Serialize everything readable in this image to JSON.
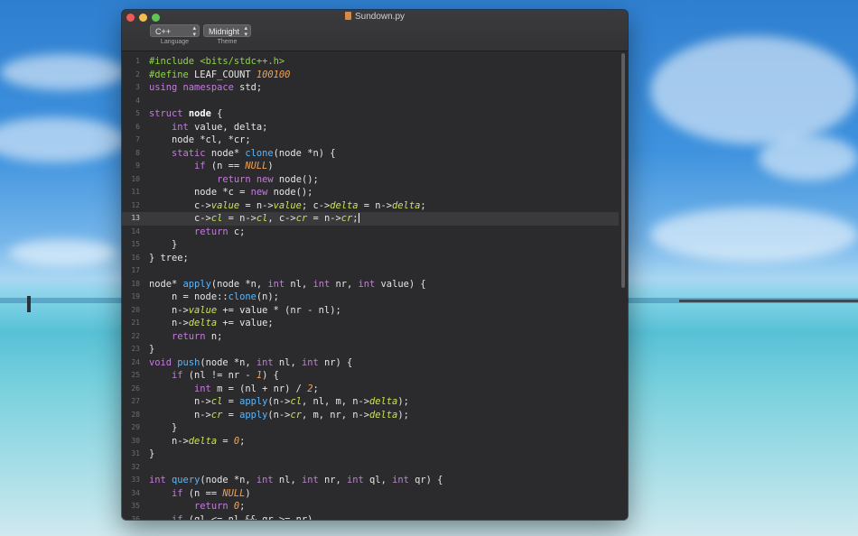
{
  "window": {
    "title": "Sundown.py"
  },
  "toolbar": {
    "language": {
      "value": "C++",
      "caption": "Language"
    },
    "theme": {
      "value": "Midnight",
      "caption": "Theme"
    }
  },
  "editor": {
    "current_line": 13,
    "lines": [
      "#include <bits/stdc++.h>",
      "#define LEAF_COUNT 100100",
      "using namespace std;",
      "",
      "struct node {",
      "    int value, delta;",
      "    node *cl, *cr;",
      "    static node* clone(node *n) {",
      "        if (n == NULL)",
      "            return new node();",
      "        node *c = new node();",
      "        c->value = n->value; c->delta = n->delta;",
      "        c->cl = n->cl, c->cr = n->cr;",
      "        return c;",
      "    }",
      "} tree;",
      "",
      "node* apply(node *n, int nl, int nr, int value) {",
      "    n = node::clone(n);",
      "    n->value += value * (nr - nl);",
      "    n->delta += value;",
      "    return n;",
      "}",
      "void push(node *n, int nl, int nr) {",
      "    if (nl != nr - 1) {",
      "        int m = (nl + nr) / 2;",
      "        n->cl = apply(n->cl, nl, m, n->delta);",
      "        n->cr = apply(n->cr, m, nr, n->delta);",
      "    }",
      "    n->delta = 0;",
      "}",
      "",
      "int query(node *n, int nl, int nr, int ql, int qr) {",
      "    if (n == NULL)",
      "        return 0;",
      "    if (ql <= nl && qr >= nr)"
    ]
  }
}
